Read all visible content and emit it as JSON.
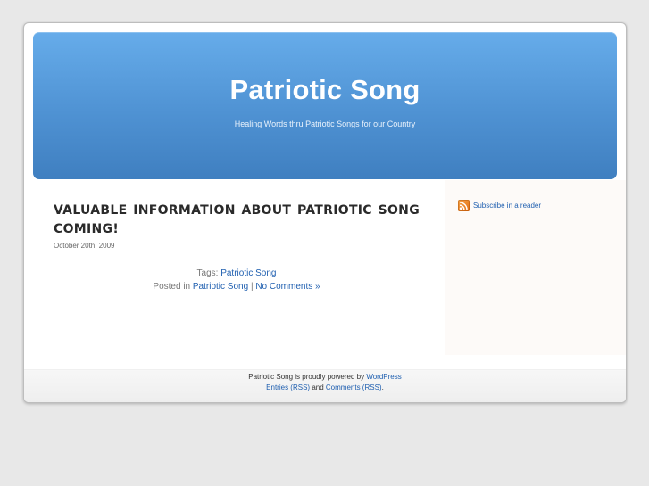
{
  "header": {
    "title": "Patriotic Song",
    "description": "Healing Words thru Patriotic Songs for our Country"
  },
  "post": {
    "title": "VALUABLE INFORMATION ABOUT PATRIOTIC SONG COMING!",
    "date": "October 20th, 2009",
    "tags_label": "Tags:",
    "tag": "Patriotic Song",
    "posted_in_label": "Posted in",
    "category": "Patriotic Song",
    "separator": "|",
    "comments_link": "No Comments »"
  },
  "sidebar": {
    "subscribe_label": "Subscribe in a reader",
    "icon": "rss-icon"
  },
  "footer": {
    "powered_prefix": "Patriotic Song is proudly powered by",
    "wordpress_link": "WordPress",
    "entries_link": "Entries (RSS)",
    "and_text": "and",
    "comments_link": "Comments (RSS)",
    "period": "."
  },
  "colors": {
    "header_top": "#66acea",
    "header_bottom": "#3f7fc0",
    "link": "#1f5fb0",
    "background": "#e8e8e8"
  }
}
